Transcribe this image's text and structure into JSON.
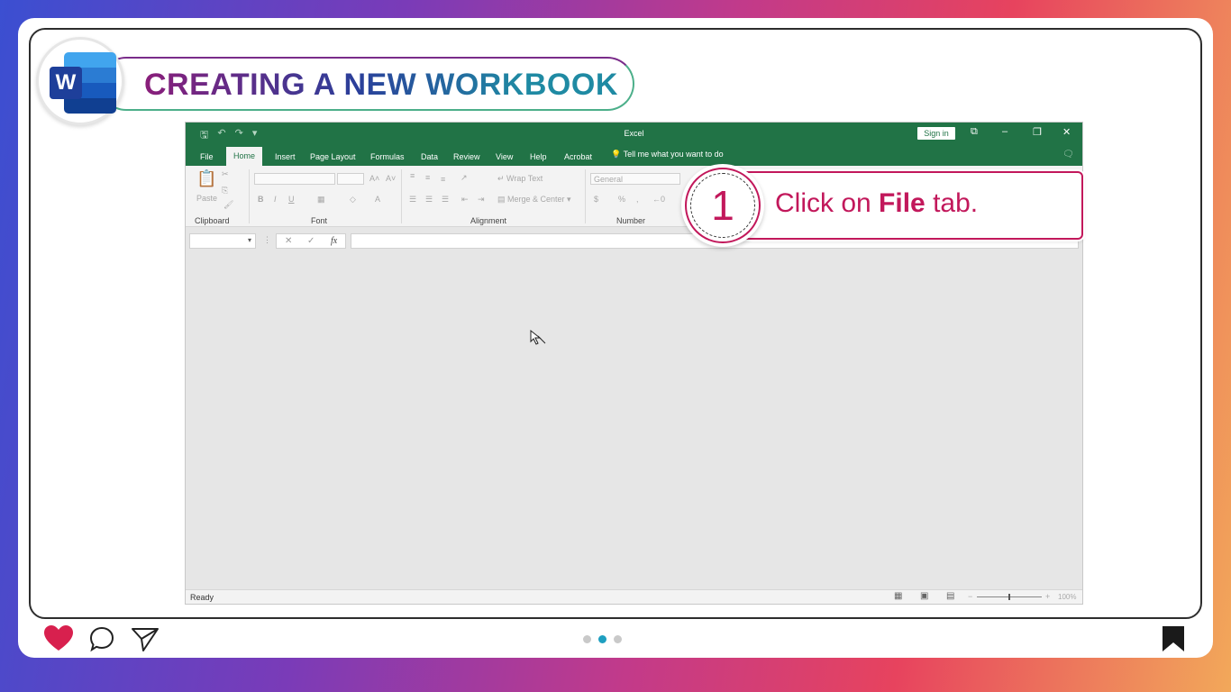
{
  "header": {
    "title": "CREATING A NEW WORKBOOK",
    "logo_letter": "W"
  },
  "excel": {
    "app_title": "Excel",
    "sign_in": "Sign in",
    "tabs": [
      "File",
      "Home",
      "Insert",
      "Page Layout",
      "Formulas",
      "Data",
      "Review",
      "View",
      "Help",
      "Acrobat"
    ],
    "active_tab": "Home",
    "tell_me": "Tell me what you want to do",
    "ribbon": {
      "paste": "Paste",
      "clipboard": "Clipboard",
      "font": "Font",
      "alignment": "Alignment",
      "number": "Number",
      "wrap_text": "Wrap Text",
      "merge_center": "Merge & Center",
      "number_format": "General"
    },
    "fx": "fx",
    "status": "Ready",
    "zoom": "100%"
  },
  "callout": {
    "step": "1",
    "text_prefix": "Click on ",
    "text_bold": "File",
    "text_suffix": " tab."
  },
  "pagination": {
    "total": 3,
    "active": 2
  },
  "colors": {
    "excel_green": "#217346",
    "accent": "#c2185b",
    "dot_active": "#1e9fc0"
  }
}
